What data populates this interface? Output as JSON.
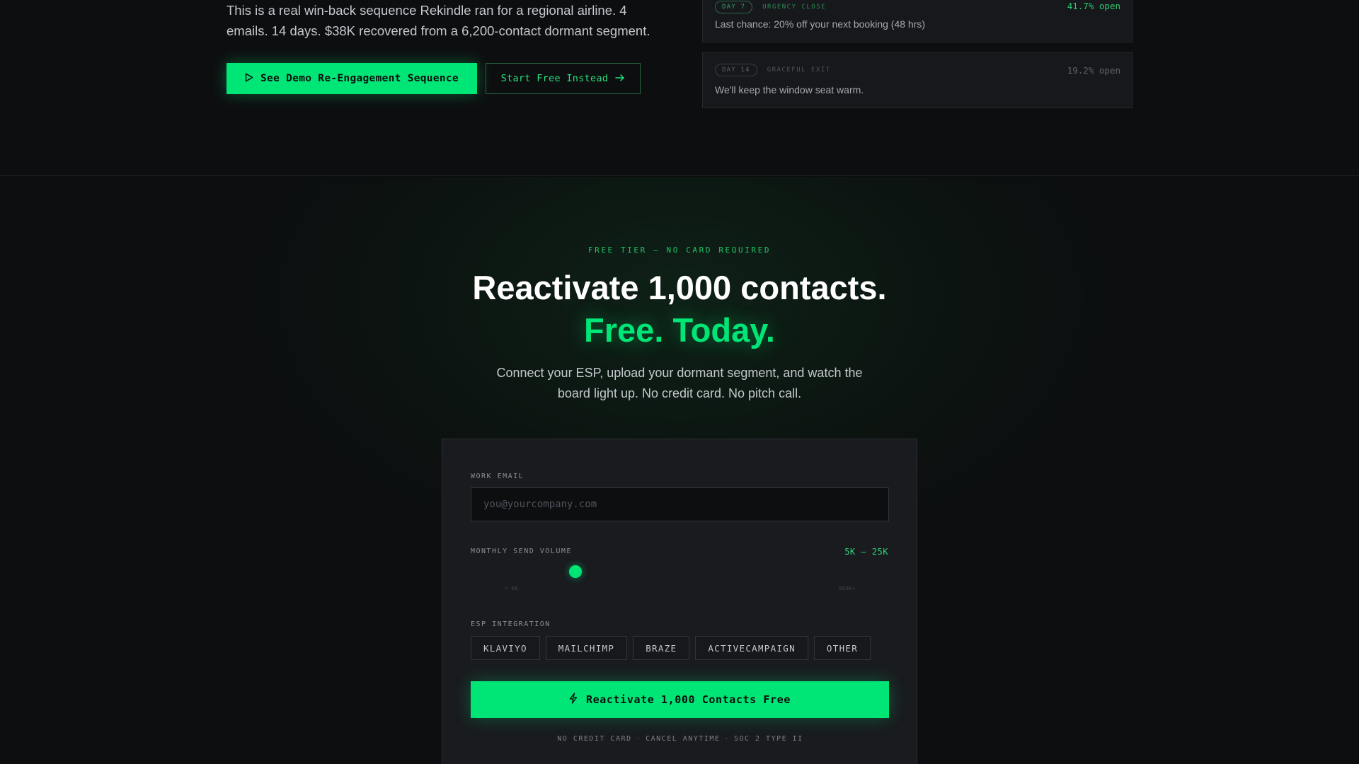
{
  "hero": {
    "intro": "This is a real win-back sequence Rekindle ran for a regional airline. 4 emails. 14 days. $38K recovered from a 6,200-contact dormant segment.",
    "demo_button": "See Demo Re-Engagement Sequence",
    "free_button": "Start Free Instead"
  },
  "sequence": [
    {
      "day": "DAY 7",
      "type": "URGENCY CLOSE",
      "open_rate": "41.7% open",
      "subject": "Last chance: 20% off your next booking (48 hrs)"
    },
    {
      "day": "DAY 14",
      "type": "GRACEFUL EXIT",
      "open_rate": "19.2% open",
      "subject": "We'll keep the window seat warm."
    }
  ],
  "signup": {
    "eyebrow": "FREE TIER — NO CARD REQUIRED",
    "headline": "Reactivate 1,000 contacts.",
    "headline_accent": "Free. Today.",
    "subcopy": "Connect your ESP, upload your dormant segment, and watch the board light up. No credit card. No pitch call."
  },
  "form": {
    "email_label": "WORK EMAIL",
    "email_placeholder": "you@yourcompany.com",
    "email_value": "",
    "volume_label": "MONTHLY SEND VOLUME",
    "volume_value": "5K – 25K",
    "volume_slider_fraction": 0.25,
    "volume_min_label": "< 5K",
    "volume_max_label": "500K+",
    "esp_label": "ESP INTEGRATION",
    "esp_options": [
      "KLAVIYO",
      "MAILCHIMP",
      "BRAZE",
      "ACTIVECAMPAIGN",
      "OTHER"
    ],
    "cta": "Reactivate 1,000 Contacts Free",
    "fine_print": [
      "NO CREDIT CARD",
      "CANCEL ANYTIME",
      "SOC 2 TYPE II"
    ],
    "fine_print_separator": "·"
  },
  "colors": {
    "accent": "#00e676",
    "background": "#0c0d0e",
    "card": "#191b1f"
  },
  "icons": {
    "demo": "play-icon",
    "free": "arrow-right-icon",
    "cta": "lightning-icon"
  }
}
